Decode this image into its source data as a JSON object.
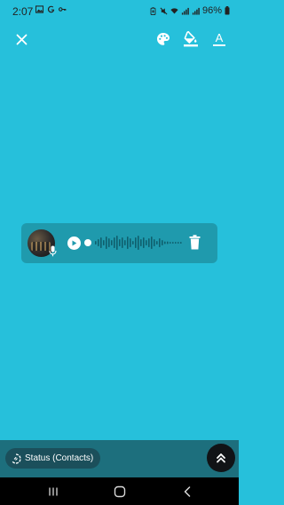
{
  "status_bar": {
    "time": "2:07",
    "battery": "96%",
    "notification_icons": [
      "gallery-icon",
      "google-icon",
      "key-icon"
    ],
    "system_icons": [
      "battery-saver-icon",
      "mute-icon",
      "wifi-icon",
      "signal-icon",
      "signal-icon"
    ]
  },
  "toolbar": {
    "close_icon": "close-icon",
    "palette_icon": "palette-icon",
    "fill_icon": "paint-bucket-icon",
    "text_icon": "text-format-icon",
    "text_glyph": "A"
  },
  "voice_note": {
    "avatar": "user-avatar",
    "mic_icon": "mic-icon",
    "play_icon": "play-icon",
    "delete_icon": "trash-icon"
  },
  "bottom_bar": {
    "audience_label": "Status (Contacts)",
    "audience_icon": "status-ring-icon",
    "send_icon": "send-icon"
  },
  "colors": {
    "background": "#26c0db",
    "card": "#1f9aad",
    "bottom_bar": "#1d6f7d",
    "chip": "#1b4f5b"
  },
  "nav_bar": {
    "recents_icon": "recents-icon",
    "home_icon": "home-icon",
    "back_icon": "back-icon"
  }
}
